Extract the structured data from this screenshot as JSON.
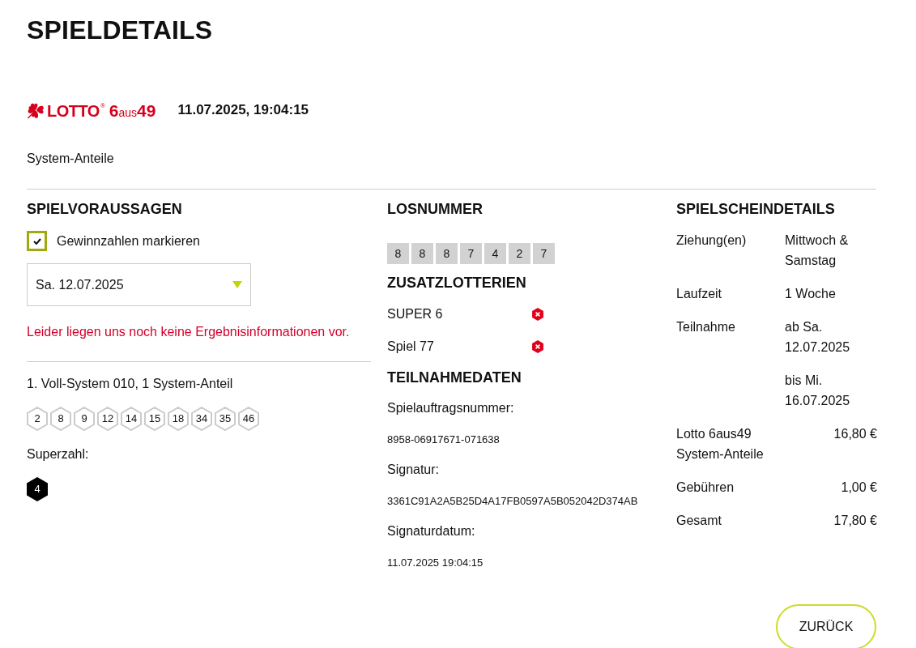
{
  "page": {
    "title": "SPIELDETAILS"
  },
  "ticket": {
    "logo": {
      "name": "LOTTO",
      "registered": "®",
      "game_parts": [
        {
          "text": "6",
          "kind": "big"
        },
        {
          "text": "aus",
          "kind": "small"
        },
        {
          "text": "49",
          "kind": "big"
        }
      ]
    },
    "timestamp": "11.07.2025, 19:04:15",
    "type": "System-Anteile"
  },
  "predictions": {
    "heading": "SPIELVORAUSSAGEN",
    "mark_winning_numbers": {
      "label": "Gewinnzahlen markieren",
      "checked": true
    },
    "draw_select": {
      "value": "Sa. 12.07.2025"
    },
    "notice": "Leider liegen uns noch keine Ergebnisinformationen vor.",
    "systems": [
      {
        "title": "1. Voll-System 010, 1 System-Anteil",
        "numbers": [
          "2",
          "8",
          "9",
          "12",
          "14",
          "15",
          "18",
          "34",
          "35",
          "46"
        ],
        "superzahl_label": "Superzahl:",
        "superzahl": "4"
      }
    ]
  },
  "ticket_number": {
    "heading": "LOSNUMMER",
    "digits": [
      "8",
      "8",
      "8",
      "7",
      "4",
      "2",
      "7"
    ]
  },
  "add_on_lotteries": {
    "heading": "ZUSATZLOTTERIEN",
    "items": [
      {
        "name": "SUPER 6",
        "participating": false
      },
      {
        "name": "Spiel 77",
        "participating": false
      }
    ]
  },
  "participation_data": {
    "heading": "TEILNAHMEDATEN",
    "fields": [
      {
        "label": "Spielauftragsnummer:",
        "value": "8958-06917671-071638"
      },
      {
        "label": "Signatur:",
        "value": "3361C91A2A5B25D4A17FB0597A5B052042D374AB"
      },
      {
        "label": "Signaturdatum:",
        "value": "11.07.2025 19:04:15"
      }
    ]
  },
  "slip_details": {
    "heading": "SPIELSCHEINDETAILS",
    "rows": [
      {
        "label": "Ziehung(en)",
        "values": [
          "Mittwoch & Samstag"
        ]
      },
      {
        "label": "Laufzeit",
        "values": [
          "1 Woche"
        ]
      },
      {
        "label": "Teilnahme",
        "values": [
          "ab Sa. 12.07.2025",
          "bis Mi. 16.07.2025"
        ]
      }
    ],
    "costs": [
      {
        "label": "Lotto 6aus49 System-Anteile",
        "amount": "16,80 €"
      },
      {
        "label": "Gebühren",
        "amount": "1,00 €"
      },
      {
        "label": "Gesamt",
        "amount": "17,80 €"
      }
    ]
  },
  "back_button": {
    "label": "ZURÜCK"
  }
}
